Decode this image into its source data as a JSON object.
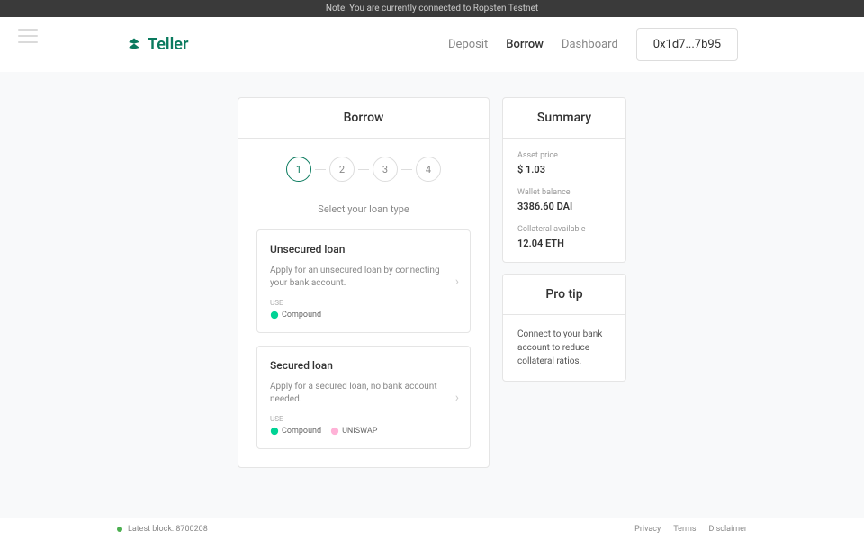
{
  "banner": "Note: You are currently connected to Ropsten Testnet",
  "logo": "Teller",
  "nav": {
    "deposit": "Deposit",
    "borrow": "Borrow",
    "dashboard": "Dashboard"
  },
  "wallet": "0x1d7...7b95",
  "borrow_card": {
    "title": "Borrow",
    "steps": [
      "1",
      "2",
      "3",
      "4"
    ],
    "select_label": "Select your loan type",
    "unsecured": {
      "title": "Unsecured loan",
      "desc": "Apply for an unsecured loan by connecting your bank account.",
      "use": "USE",
      "compound": "Compound"
    },
    "secured": {
      "title": "Secured loan",
      "desc": "Apply for a secured loan, no bank account needed.",
      "use": "USE",
      "compound": "Compound",
      "uniswap": "UNISWAP"
    }
  },
  "summary": {
    "title": "Summary",
    "asset_price_label": "Asset price",
    "asset_price": "$ 1.03",
    "wallet_label": "Wallet balance",
    "wallet_value": "3386.60 DAI",
    "collateral_label": "Collateral available",
    "collateral_value": "12.04 ETH"
  },
  "protip": {
    "title": "Pro tip",
    "text": "Connect to your bank account to reduce collateral ratios."
  },
  "footer": {
    "block": "Latest block: 8700208",
    "privacy": "Privacy",
    "terms": "Terms",
    "disclaimer": "Disclaimer"
  }
}
